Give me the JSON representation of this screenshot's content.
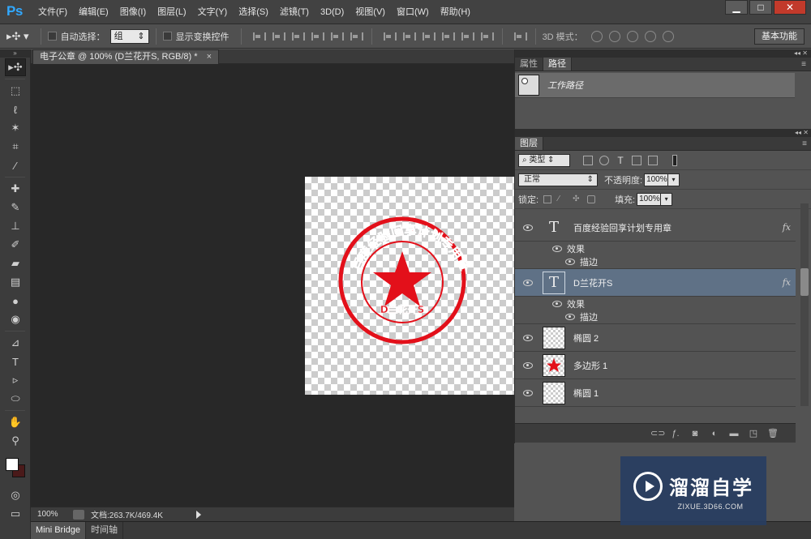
{
  "app": {
    "logo": "Ps",
    "menu": [
      "文件(F)",
      "编辑(E)",
      "图像(I)",
      "图层(L)",
      "文字(Y)",
      "选择(S)",
      "滤镜(T)",
      "3D(D)",
      "视图(V)",
      "窗口(W)",
      "帮助(H)"
    ],
    "window_controls": [
      "▁",
      "□",
      "✕"
    ]
  },
  "options": {
    "auto_select_label": "自动选择：",
    "auto_select_value": "组",
    "show_transform_label": "显示变换控件",
    "mode_3d_label": "3D 模式：",
    "workspace": "基本功能"
  },
  "document": {
    "tab_title": "电子公章 @ 100% (D兰花开S, RGB/8) *",
    "tab_close": "×",
    "stamp": {
      "outer_text": "百度经验回享计划专用章",
      "inner_text": "D兰花开S",
      "color": "#e3101a"
    }
  },
  "status": {
    "zoom": "100%",
    "doc_info": "文档:263.7K/469.4K"
  },
  "bottom_tabs": [
    "Mini Bridge",
    "时间轴"
  ],
  "panels": {
    "top_tabs": [
      "属性",
      "路径"
    ],
    "path_name": "工作路径",
    "layers_tab": "图层",
    "filter": "类型",
    "blend_mode": "正常",
    "opacity_label": "不透明度:",
    "opacity": "100%",
    "lock_label": "锁定:",
    "fill_label": "填充:",
    "fill": "100%",
    "fx": "fx",
    "effects_label": "效果",
    "stroke_label": "描边",
    "layers": [
      {
        "name": "百度经验回享计划专用章",
        "type": "text"
      },
      {
        "name": "D兰花开S",
        "type": "text"
      },
      {
        "name": "椭圆 2",
        "type": "shape"
      },
      {
        "name": "多边形 1",
        "type": "shape"
      },
      {
        "name": "椭圆 1",
        "type": "shape"
      }
    ]
  },
  "watermark": {
    "title": "溜溜自学",
    "url": "ZIXUE.3D66.COM"
  }
}
